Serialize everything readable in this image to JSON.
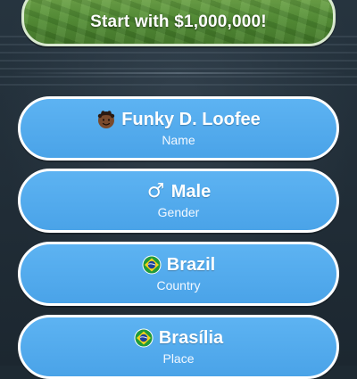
{
  "start_button": {
    "label": "Start with $1,000,000!"
  },
  "options": [
    {
      "id": "name",
      "value": "Funky D. Loofee",
      "caption": "Name",
      "icon": "avatar-icon"
    },
    {
      "id": "gender",
      "value": "Male",
      "caption": "Gender",
      "icon": "male-symbol-icon"
    },
    {
      "id": "country",
      "value": "Brazil",
      "caption": "Country",
      "icon": "brazil-flag-icon"
    },
    {
      "id": "place",
      "value": "Brasília",
      "caption": "Place",
      "icon": "brazil-flag-icon"
    }
  ],
  "colors": {
    "option_fill": "#4aa3e8",
    "option_border": "#ffffff",
    "money_green": "#4f8a33",
    "background": "#1e2a33"
  }
}
